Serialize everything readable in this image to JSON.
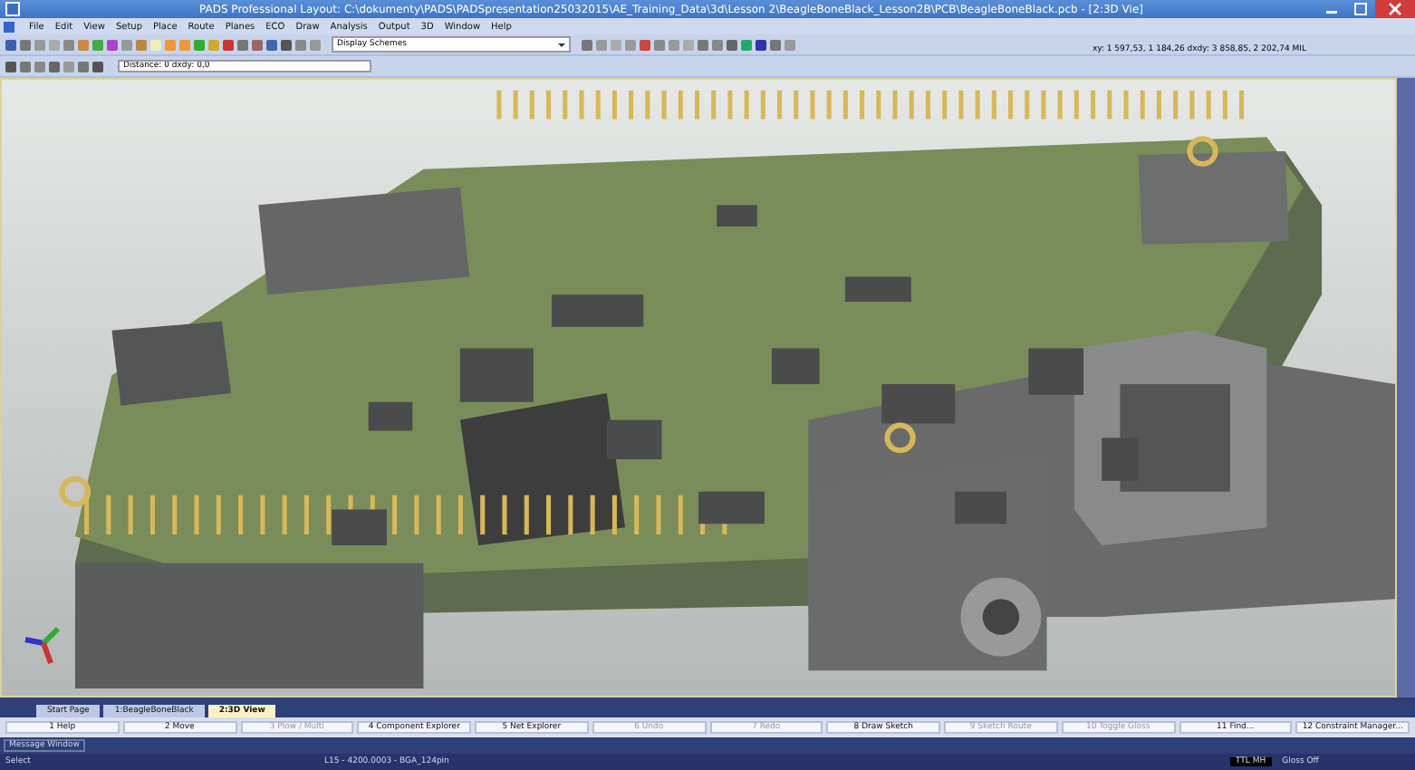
{
  "window": {
    "title": "PADS Professional Layout: C:\\dokumenty\\PADS\\PADSpresentation25032015\\AE_Training_Data\\3d\\Lesson 2\\BeagleBoneBlack_Lesson2B\\PCB\\BeagleBoneBlack.pcb - [2:3D Vie]"
  },
  "menu": [
    "File",
    "Edit",
    "View",
    "Setup",
    "Place",
    "Route",
    "Planes",
    "ECO",
    "Draw",
    "Analysis",
    "Output",
    "3D",
    "Window",
    "Help"
  ],
  "toolbar": {
    "scheme_dropdown": "Display Schemes",
    "coordinates": "xy: 1 597,53, 1 184,26 dxdy: 3 858,85, 2 202,74 MIL"
  },
  "distance_field": {
    "value": "Distance: 0 dxdy: 0,0"
  },
  "tabs": [
    {
      "label": "Start Page",
      "selected": false
    },
    {
      "label": "1:BeagleBoneBlack",
      "selected": false
    },
    {
      "label": "2:3D View",
      "selected": true
    }
  ],
  "function_keys": [
    {
      "label": "1 Help",
      "disabled": false
    },
    {
      "label": "2 Move",
      "disabled": false
    },
    {
      "label": "3 Plow / Multi",
      "disabled": true
    },
    {
      "label": "4 Component Explorer",
      "disabled": false
    },
    {
      "label": "5 Net Explorer",
      "disabled": false
    },
    {
      "label": "6 Undo",
      "disabled": true
    },
    {
      "label": "7 Redo",
      "disabled": true
    },
    {
      "label": "8 Draw Sketch",
      "disabled": false
    },
    {
      "label": "9 Sketch Route",
      "disabled": true
    },
    {
      "label": "10 Toggle Gloss",
      "disabled": true
    },
    {
      "label": "11 Find...",
      "disabled": false
    },
    {
      "label": "12 Constraint Manager...",
      "disabled": false
    }
  ],
  "message_window": {
    "label": "Message Window"
  },
  "status_bar": {
    "mode": "Select",
    "layer": "L15 - 4200.0003 - BGA_124pin",
    "units": "TTL MH",
    "gloss": "Gloss Off"
  }
}
